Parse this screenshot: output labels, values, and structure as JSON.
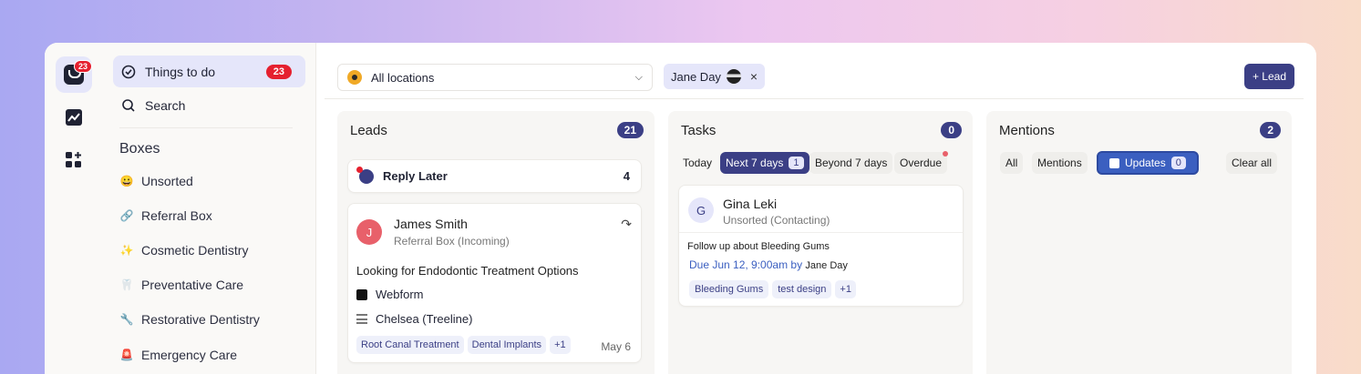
{
  "rail": {
    "badge_count": "23"
  },
  "sidenav": {
    "things_to_do": {
      "label": "Things to do",
      "count": "23"
    },
    "search": {
      "label": "Search"
    },
    "boxes_title": "Boxes",
    "boxes": [
      {
        "label": "Unsorted",
        "emoji": "😀"
      },
      {
        "label": "Referral Box",
        "emoji": "🔗"
      },
      {
        "label": "Cosmetic Dentistry",
        "emoji": "✨"
      },
      {
        "label": "Preventative Care",
        "emoji": "🦷"
      },
      {
        "label": "Restorative Dentistry",
        "emoji": "🔧"
      },
      {
        "label": "Emergency Care",
        "emoji": "🚨"
      }
    ]
  },
  "topbar": {
    "location": "All locations",
    "user_filter": "Jane Day",
    "lead_button": "+ Lead"
  },
  "leads": {
    "title": "Leads",
    "count": "21",
    "reply_later": {
      "label": "Reply Later",
      "count": "4"
    },
    "card": {
      "initial": "J",
      "name": "James Smith",
      "box": "Referral Box (Incoming)",
      "subject": "Looking for Endodontic Treatment Options",
      "source": "Webform",
      "location": "Chelsea (Treeline)",
      "tags": [
        "Root Canal Treatment",
        "Dental Implants",
        "+1"
      ],
      "date": "May 6"
    }
  },
  "tasks": {
    "title": "Tasks",
    "count": "0",
    "filters": {
      "today": "Today",
      "next7": "Next 7 days",
      "next7_count": "1",
      "beyond7": "Beyond 7 days",
      "overdue": "Overdue"
    },
    "card": {
      "initial": "G",
      "name": "Gina Leki",
      "box": "Unsorted (Contacting)",
      "task": "Follow up about Bleeding Gums",
      "due": "Due Jun 12, 9:00am by",
      "assignee": "Jane Day",
      "tags": [
        "Bleeding Gums",
        "test design",
        "+1"
      ]
    }
  },
  "mentions": {
    "title": "Mentions",
    "count": "2",
    "filters": {
      "all": "All",
      "mentions": "Mentions",
      "updates": "Updates",
      "updates_count": "0",
      "clear_all": "Clear all"
    }
  },
  "colors": {
    "accent": "#3b3f85",
    "badge_red": "#e5202f",
    "avatar_j": "#e8606a"
  }
}
